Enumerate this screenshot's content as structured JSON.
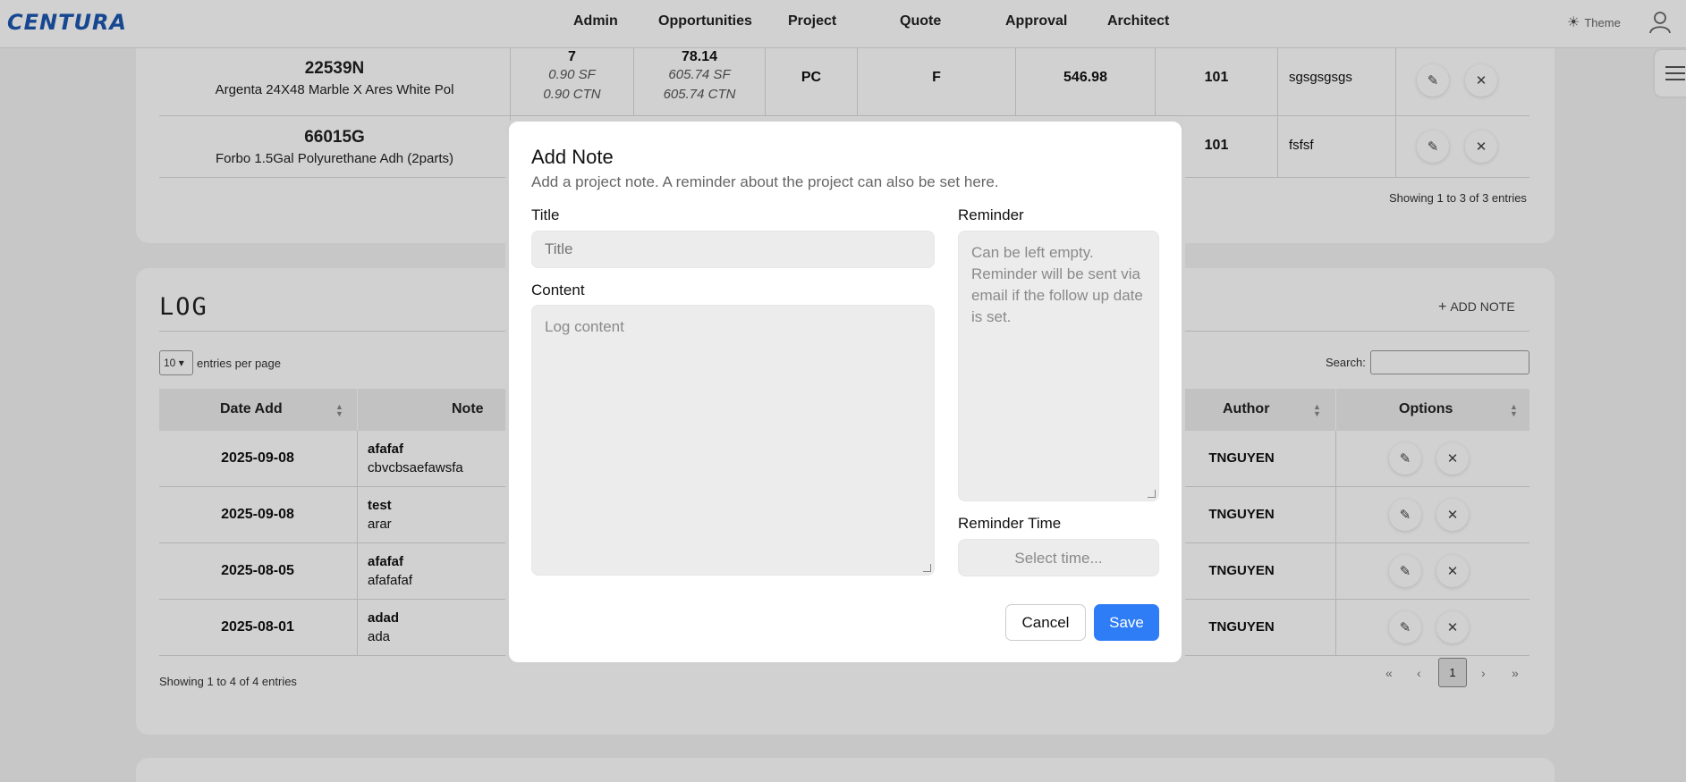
{
  "brand": {
    "logo": "CENTURA"
  },
  "nav": {
    "items": [
      "Admin",
      "Opportunities",
      "Project",
      "Quote",
      "Approval",
      "Architect"
    ]
  },
  "header": {
    "theme_label": "Theme"
  },
  "quote_table": {
    "rows": [
      {
        "code": "22539N",
        "desc": "Argenta 24X48 Marble X Ares White Pol",
        "qty": "7",
        "qty_sf": "0.90 SF",
        "qty_ctn": "0.90 CTN",
        "total": "78.14",
        "total_sf": "605.74 SF",
        "total_ctn": "605.74 CTN",
        "type": "PC",
        "status": "F",
        "price": "546.98",
        "location": "101",
        "comment": "sgsgsgsgs"
      },
      {
        "code": "66015G",
        "desc": "Forbo 1.5Gal Polyurethane Adh (2parts)",
        "location": "101",
        "comment": "fsfsf"
      }
    ],
    "showing": "Showing 1 to 3 of 3 entries"
  },
  "log": {
    "title": "LOG",
    "add_note": "ADD NOTE",
    "per_page_value": "10",
    "per_page_label": "entries per page",
    "search_label": "Search:",
    "columns": {
      "date": "Date Add",
      "note": "Note",
      "author": "Author",
      "options": "Options"
    },
    "rows": [
      {
        "date": "2025-09-08",
        "title": "afafaf",
        "body": "cbvcbsaefawsfa",
        "author": "TNGUYEN"
      },
      {
        "date": "2025-09-08",
        "title": "test",
        "body": "arar",
        "author": "TNGUYEN"
      },
      {
        "date": "2025-08-05",
        "title": "afafaf",
        "body": "afafafaf",
        "author": "TNGUYEN"
      },
      {
        "date": "2025-08-01",
        "title": "adad",
        "body": "ada",
        "author": "TNGUYEN"
      }
    ],
    "showing": "Showing 1 to 4 of 4 entries",
    "pager": {
      "first": "«",
      "prev": "‹",
      "current": "1",
      "next": "›",
      "last": "»"
    }
  },
  "modal": {
    "title": "Add Note",
    "subtitle": "Add a project note. A reminder about the project can also be set here.",
    "title_label": "Title",
    "title_placeholder": "Title",
    "content_label": "Content",
    "content_placeholder": "Log content",
    "reminder_label": "Reminder",
    "reminder_placeholder": "Can be left empty. Reminder will be sent via email if the follow up date is set.",
    "reminder_time_label": "Reminder Time",
    "reminder_time_placeholder": "Select time...",
    "cancel": "Cancel",
    "save": "Save"
  },
  "colors": {
    "brand": "#1b57b0",
    "primary_button": "#2f7df6"
  }
}
